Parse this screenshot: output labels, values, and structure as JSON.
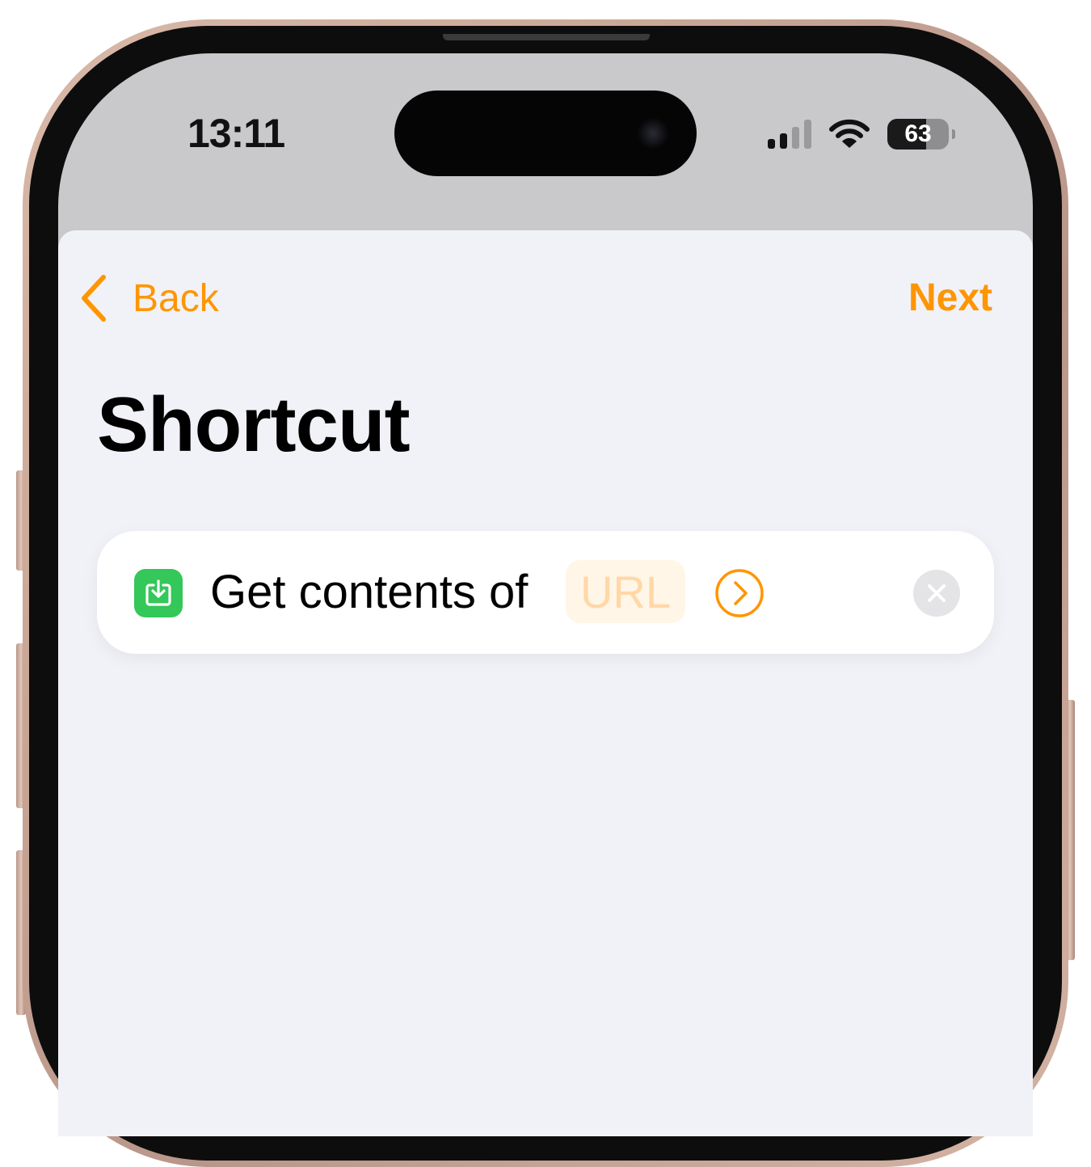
{
  "status_bar": {
    "time": "13:11",
    "battery_level": "63"
  },
  "nav": {
    "back_label": "Back",
    "next_label": "Next"
  },
  "page": {
    "title": "Shortcut"
  },
  "action": {
    "text": "Get contents of",
    "parameter_placeholder": "URL",
    "icon": "download-tray-icon"
  },
  "colors": {
    "accent": "#ff9500",
    "action_icon_bg": "#34c759",
    "sheet_bg": "#f1f2f7"
  }
}
